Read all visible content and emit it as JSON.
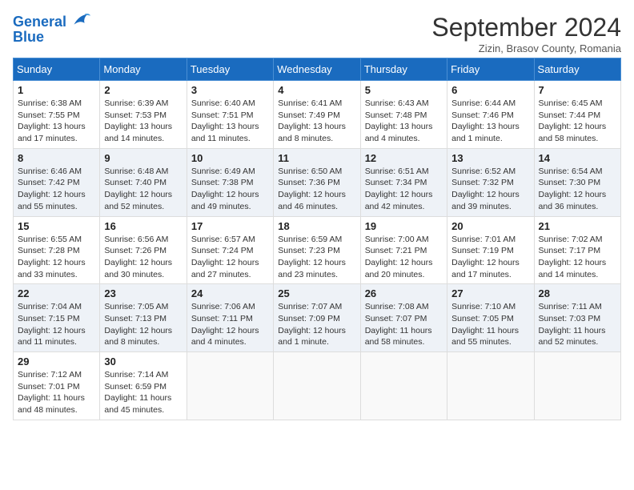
{
  "header": {
    "logo_line1": "General",
    "logo_line2": "Blue",
    "month_title": "September 2024",
    "subtitle": "Zizin, Brasov County, Romania"
  },
  "days_of_week": [
    "Sunday",
    "Monday",
    "Tuesday",
    "Wednesday",
    "Thursday",
    "Friday",
    "Saturday"
  ],
  "weeks": [
    [
      {
        "day": "1",
        "sunrise": "6:38 AM",
        "sunset": "7:55 PM",
        "daylight": "13 hours and 17 minutes."
      },
      {
        "day": "2",
        "sunrise": "6:39 AM",
        "sunset": "7:53 PM",
        "daylight": "13 hours and 14 minutes."
      },
      {
        "day": "3",
        "sunrise": "6:40 AM",
        "sunset": "7:51 PM",
        "daylight": "13 hours and 11 minutes."
      },
      {
        "day": "4",
        "sunrise": "6:41 AM",
        "sunset": "7:49 PM",
        "daylight": "13 hours and 8 minutes."
      },
      {
        "day": "5",
        "sunrise": "6:43 AM",
        "sunset": "7:48 PM",
        "daylight": "13 hours and 4 minutes."
      },
      {
        "day": "6",
        "sunrise": "6:44 AM",
        "sunset": "7:46 PM",
        "daylight": "13 hours and 1 minute."
      },
      {
        "day": "7",
        "sunrise": "6:45 AM",
        "sunset": "7:44 PM",
        "daylight": "12 hours and 58 minutes."
      }
    ],
    [
      {
        "day": "8",
        "sunrise": "6:46 AM",
        "sunset": "7:42 PM",
        "daylight": "12 hours and 55 minutes."
      },
      {
        "day": "9",
        "sunrise": "6:48 AM",
        "sunset": "7:40 PM",
        "daylight": "12 hours and 52 minutes."
      },
      {
        "day": "10",
        "sunrise": "6:49 AM",
        "sunset": "7:38 PM",
        "daylight": "12 hours and 49 minutes."
      },
      {
        "day": "11",
        "sunrise": "6:50 AM",
        "sunset": "7:36 PM",
        "daylight": "12 hours and 46 minutes."
      },
      {
        "day": "12",
        "sunrise": "6:51 AM",
        "sunset": "7:34 PM",
        "daylight": "12 hours and 42 minutes."
      },
      {
        "day": "13",
        "sunrise": "6:52 AM",
        "sunset": "7:32 PM",
        "daylight": "12 hours and 39 minutes."
      },
      {
        "day": "14",
        "sunrise": "6:54 AM",
        "sunset": "7:30 PM",
        "daylight": "12 hours and 36 minutes."
      }
    ],
    [
      {
        "day": "15",
        "sunrise": "6:55 AM",
        "sunset": "7:28 PM",
        "daylight": "12 hours and 33 minutes."
      },
      {
        "day": "16",
        "sunrise": "6:56 AM",
        "sunset": "7:26 PM",
        "daylight": "12 hours and 30 minutes."
      },
      {
        "day": "17",
        "sunrise": "6:57 AM",
        "sunset": "7:24 PM",
        "daylight": "12 hours and 27 minutes."
      },
      {
        "day": "18",
        "sunrise": "6:59 AM",
        "sunset": "7:23 PM",
        "daylight": "12 hours and 23 minutes."
      },
      {
        "day": "19",
        "sunrise": "7:00 AM",
        "sunset": "7:21 PM",
        "daylight": "12 hours and 20 minutes."
      },
      {
        "day": "20",
        "sunrise": "7:01 AM",
        "sunset": "7:19 PM",
        "daylight": "12 hours and 17 minutes."
      },
      {
        "day": "21",
        "sunrise": "7:02 AM",
        "sunset": "7:17 PM",
        "daylight": "12 hours and 14 minutes."
      }
    ],
    [
      {
        "day": "22",
        "sunrise": "7:04 AM",
        "sunset": "7:15 PM",
        "daylight": "12 hours and 11 minutes."
      },
      {
        "day": "23",
        "sunrise": "7:05 AM",
        "sunset": "7:13 PM",
        "daylight": "12 hours and 8 minutes."
      },
      {
        "day": "24",
        "sunrise": "7:06 AM",
        "sunset": "7:11 PM",
        "daylight": "12 hours and 4 minutes."
      },
      {
        "day": "25",
        "sunrise": "7:07 AM",
        "sunset": "7:09 PM",
        "daylight": "12 hours and 1 minute."
      },
      {
        "day": "26",
        "sunrise": "7:08 AM",
        "sunset": "7:07 PM",
        "daylight": "11 hours and 58 minutes."
      },
      {
        "day": "27",
        "sunrise": "7:10 AM",
        "sunset": "7:05 PM",
        "daylight": "11 hours and 55 minutes."
      },
      {
        "day": "28",
        "sunrise": "7:11 AM",
        "sunset": "7:03 PM",
        "daylight": "11 hours and 52 minutes."
      }
    ],
    [
      {
        "day": "29",
        "sunrise": "7:12 AM",
        "sunset": "7:01 PM",
        "daylight": "11 hours and 48 minutes."
      },
      {
        "day": "30",
        "sunrise": "7:14 AM",
        "sunset": "6:59 PM",
        "daylight": "11 hours and 45 minutes."
      },
      null,
      null,
      null,
      null,
      null
    ]
  ]
}
